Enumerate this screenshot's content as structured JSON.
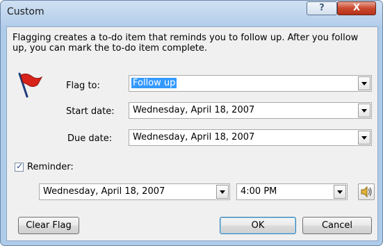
{
  "window": {
    "title": "Custom",
    "help_glyph": "?",
    "close_glyph": "X"
  },
  "message": "Flagging creates a to-do item that reminds you to follow up. After you follow up, you can mark the to-do item complete.",
  "fields": {
    "flag_to": {
      "label": "Flag to:",
      "value": "Follow up"
    },
    "start_date": {
      "label": "Start date:",
      "value": "Wednesday, April 18, 2007"
    },
    "due_date": {
      "label": "Due date:",
      "value": "Wednesday, April 18, 2007"
    }
  },
  "reminder": {
    "label": "Reminder:",
    "checked": true,
    "date": "Wednesday, April 18, 2007",
    "time": "4:00 PM"
  },
  "buttons": {
    "clear_flag": "Clear Flag",
    "ok": "OK",
    "cancel": "Cancel"
  },
  "icons": {
    "flag": "red-flag-icon",
    "sound": "speaker-icon"
  },
  "colors": {
    "flag_red": "#d8231b",
    "selection": "#3399ff",
    "close_red": "#c9482d"
  }
}
